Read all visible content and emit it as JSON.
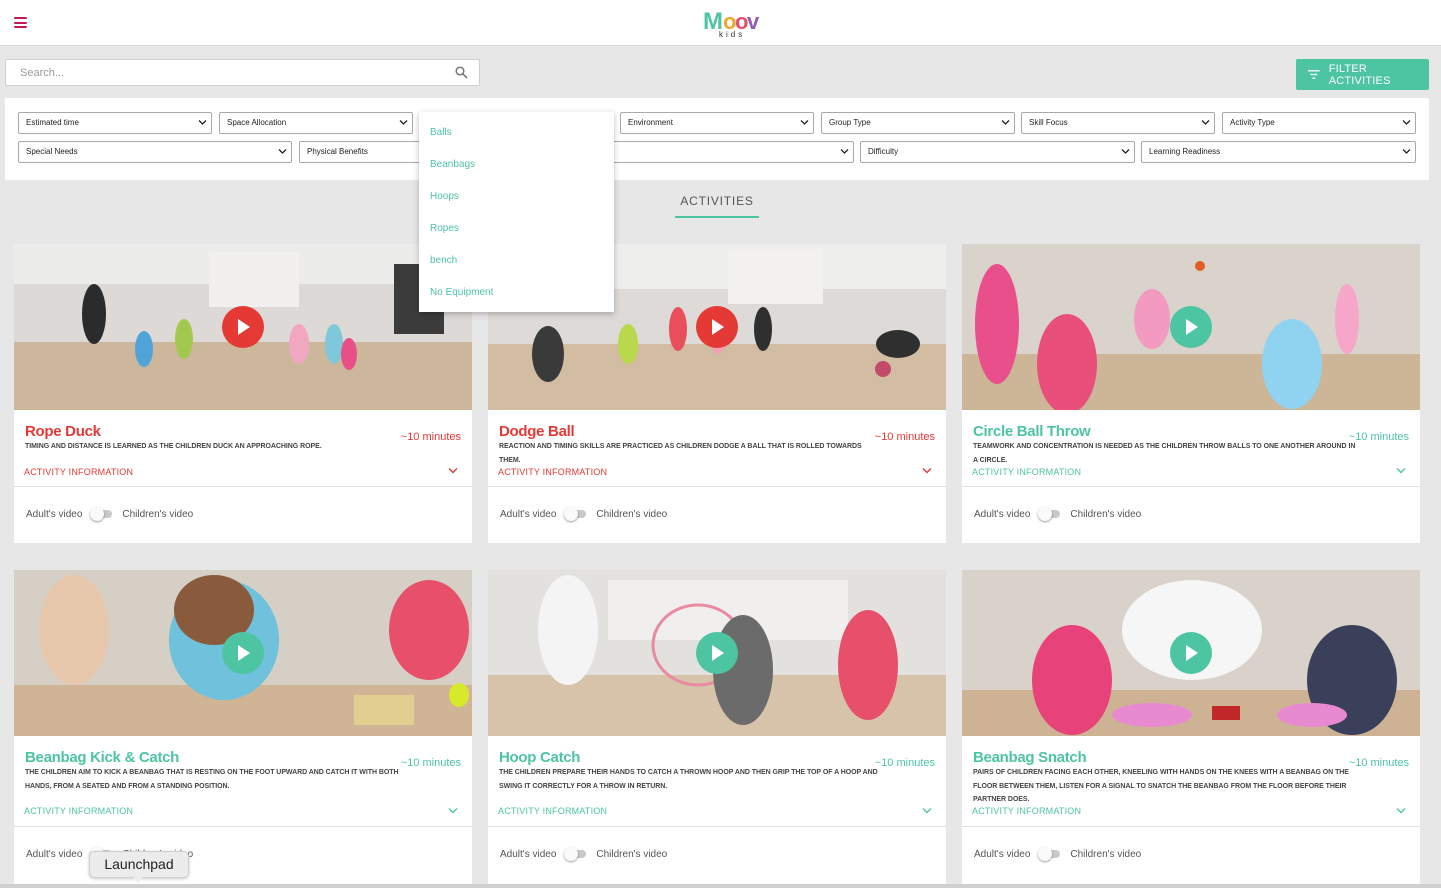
{
  "header": {
    "logo_text": "Moov kids"
  },
  "search": {
    "placeholder": "Search..."
  },
  "filter_button": {
    "label": "FILTER ACTIVITIES"
  },
  "filters": {
    "row1": [
      "Estimated time",
      "Space Allocation",
      "",
      "Environment",
      "Group Type",
      "Skill Focus",
      "Activity Type"
    ],
    "row2": [
      "Special Needs",
      "Physical Benefits",
      "",
      "Difficulty",
      "Learning Readiness"
    ]
  },
  "equipment_dropdown": {
    "options": [
      "Balls",
      "Beanbags",
      "Hoops",
      "Ropes",
      "bench",
      "No Equipment"
    ]
  },
  "section": {
    "title": "ACTIVITIES"
  },
  "toggle_labels": {
    "adult": "Adult's video",
    "children": "Children's video"
  },
  "info_label": "ACTIVITY INFORMATION",
  "colors": {
    "accent_green": "#4dc4a2",
    "accent_red": "#e53935",
    "logo_magenta": "#c2185b"
  },
  "cards": [
    {
      "title": "Rope Duck",
      "time": "~10 minutes",
      "desc": "Timing and distance is learned as the children duck an approaching rope.",
      "theme": "red"
    },
    {
      "title": "Dodge Ball",
      "time": "~10 minutes",
      "desc": "Reaction and timing skills are practiced as children dodge a ball that is rolled towards them.",
      "theme": "red"
    },
    {
      "title": "Circle Ball Throw",
      "time": "~10 minutes",
      "desc": "Teamwork and concentration is needed as the children throw balls to one another around in a circle.",
      "theme": "green"
    },
    {
      "title": "Beanbag Kick & Catch",
      "time": "~10 minutes",
      "desc": "The children aim to kick a beanbag that is resting on the foot upward and catch it with both hands, from a seated and from a standing position.",
      "theme": "green"
    },
    {
      "title": "Hoop Catch",
      "time": "~10 minutes",
      "desc": "The children prepare their hands to catch a thrown hoop and then grip the top of a hoop and swing it correctly for a throw in return.",
      "theme": "green"
    },
    {
      "title": "Beanbag Snatch",
      "time": "~10 minutes",
      "desc": "Pairs of children facing each other, kneeling with hands on the knees with a beanbag on the floor between them, listen for a signal to snatch the beanbag from the floor before their partner does.",
      "theme": "green"
    }
  ],
  "launchpad": {
    "label": "Launchpad"
  }
}
